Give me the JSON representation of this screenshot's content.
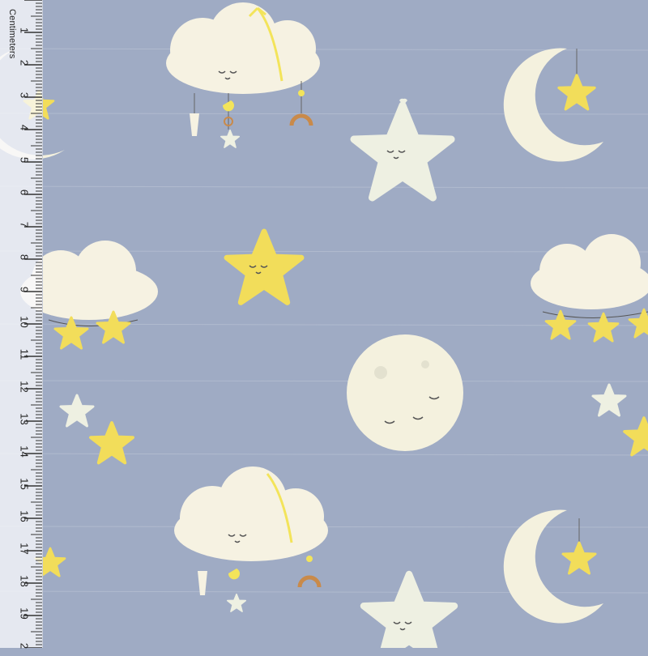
{
  "ruler": {
    "label": "Centimeters",
    "numbers": [
      "1",
      "2",
      "3",
      "4",
      "5",
      "6",
      "7",
      "8",
      "9",
      "10",
      "11",
      "12",
      "13",
      "14",
      "15",
      "16",
      "17",
      "18",
      "19",
      "2"
    ]
  },
  "colors": {
    "fabric": "#9fabc4",
    "cloud": "#f6f2e2",
    "moon": "#f4f1de",
    "star_pale": "#eef0e2",
    "star_yellow": "#f2dd5a",
    "ribbon": "#f3e45a"
  },
  "motifs": [
    "cloud-icon",
    "moon-icon",
    "star-icon",
    "full-moon-icon"
  ]
}
